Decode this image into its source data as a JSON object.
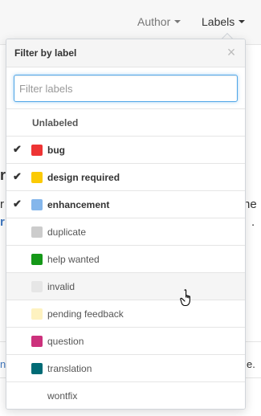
{
  "filters": {
    "author_label": "Author",
    "labels_label": "Labels"
  },
  "background": {
    "frag_bold": "r",
    "frag_r": "r",
    "frag_r2": "r",
    "frag_he": "he",
    "frag_dot": ".",
    "frag_n": "n",
    "frag_e": "e."
  },
  "dropdown": {
    "title": "Filter by label",
    "close_glyph": "×",
    "filter_placeholder": "Filter labels",
    "filter_value": "",
    "unlabeled": "Unlabeled",
    "check_glyph": "✔",
    "labels": [
      {
        "name": "bug",
        "color": "#ee3434",
        "selected": true
      },
      {
        "name": "design required",
        "color": "#fbca04",
        "selected": true
      },
      {
        "name": "enhancement",
        "color": "#84b6eb",
        "selected": true
      },
      {
        "name": "duplicate",
        "color": "#cccccc",
        "selected": false
      },
      {
        "name": "help wanted",
        "color": "#159818",
        "selected": false
      },
      {
        "name": "invalid",
        "color": "#e6e6e6",
        "selected": false,
        "hover": true
      },
      {
        "name": "pending feedback",
        "color": "#fef2c0",
        "selected": false
      },
      {
        "name": "question",
        "color": "#cc317c",
        "selected": false
      },
      {
        "name": "translation",
        "color": "#006b75",
        "selected": false
      },
      {
        "name": "wontfix",
        "color": "#ffffff",
        "selected": false
      }
    ]
  }
}
